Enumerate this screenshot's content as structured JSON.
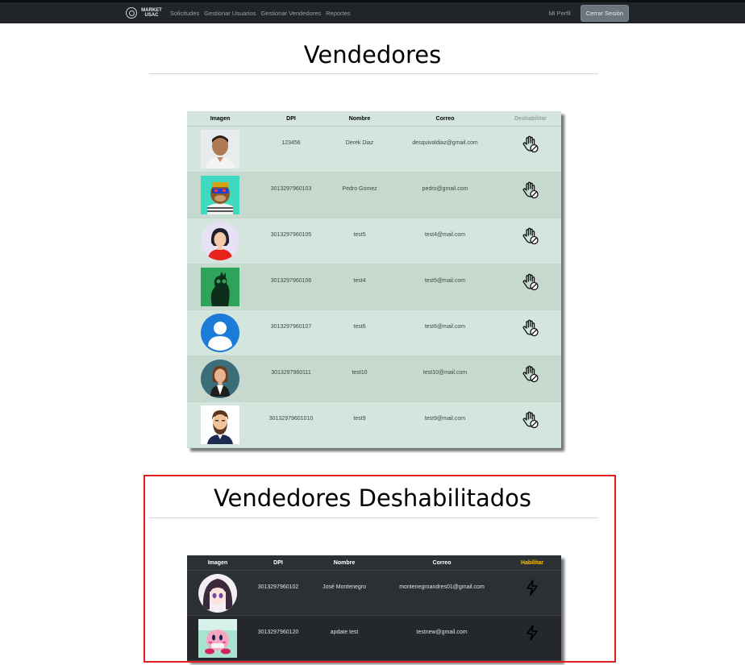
{
  "nav": {
    "brand": "MARKET USAC",
    "links": [
      "Solicitudes",
      "Gestionar Usuarios",
      "Gestionar Vendedores",
      "Reportes"
    ],
    "profile": "Mi Perfil",
    "logout": "Cerrar Sesión"
  },
  "active_section": {
    "title": "Vendedores",
    "headers": [
      "Imagen",
      "DPI",
      "Nombre",
      "Correo",
      "Deshabilitar"
    ],
    "rows": [
      {
        "dpi": "123456",
        "nombre": "Derek Diaz",
        "correo": "desquivaldiaz@gmail.com",
        "avatar": "man-photo"
      },
      {
        "dpi": "3013297960103",
        "nombre": "Pedro Gomez",
        "correo": "pedro@gmail.com",
        "avatar": "ape-nft"
      },
      {
        "dpi": "3013297960105",
        "nombre": "test5",
        "correo": "test4@mail.com",
        "avatar": "woman-red-shirt"
      },
      {
        "dpi": "3013297960106",
        "nombre": "test4",
        "correo": "test5@mail.com",
        "avatar": "green-creature"
      },
      {
        "dpi": "3013297960107",
        "nombre": "test6",
        "correo": "test6@mail.com",
        "avatar": "default-user"
      },
      {
        "dpi": "3013297960111",
        "nombre": "test10",
        "correo": "test10@mail.com",
        "avatar": "woman-teal-circle"
      },
      {
        "dpi": "30132979601010",
        "nombre": "test9",
        "correo": "test9@mail.com",
        "avatar": "bearded-man"
      }
    ],
    "action_icon": "hand-disable-icon"
  },
  "disabled_section": {
    "title": "Vendedores Deshabilitados",
    "headers": [
      "Imagen",
      "DPI",
      "Nombre",
      "Correo",
      "Habilitar"
    ],
    "rows": [
      {
        "dpi": "3013297960102",
        "nombre": "José Montenegro",
        "correo": "montenegroandres01@gmail.com",
        "avatar": "anime-girl"
      },
      {
        "dpi": "3013297960120",
        "nombre": "apdate test",
        "correo": "testnew@gmail.com",
        "avatar": "kirby"
      }
    ],
    "action_icon": "lightning-icon"
  },
  "colors": {
    "navbar": "#212529",
    "light_table": "#d3e5dc",
    "dark_table": "#2b3035",
    "enable_header": "#ffc107",
    "highlight": "#e02020"
  }
}
